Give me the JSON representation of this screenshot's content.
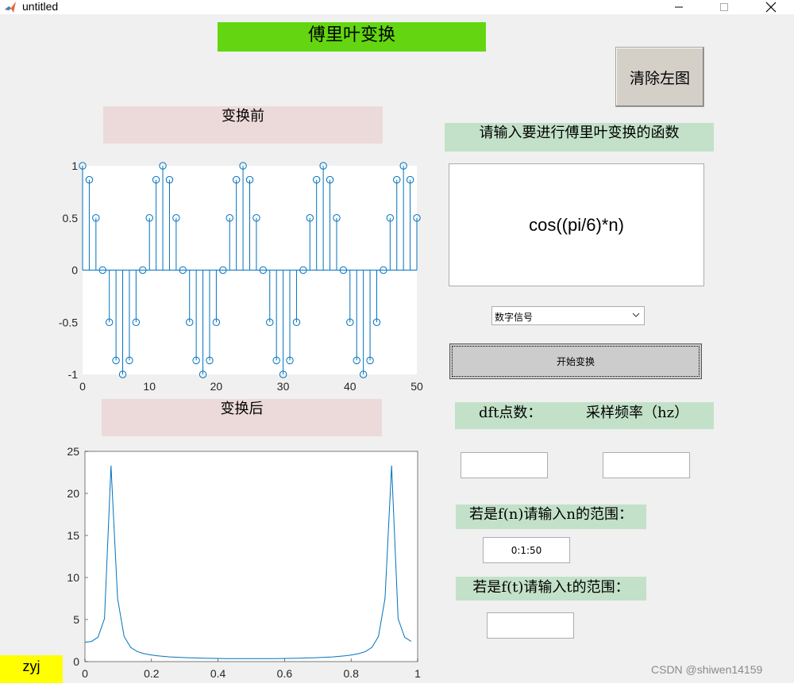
{
  "window": {
    "title": "untitled"
  },
  "banner": "傅里叶变换",
  "clear_button": "清除左图",
  "labels": {
    "before": "变换前",
    "after": "变换后",
    "input_prompt": "请输入要进行傅里叶变换的函数",
    "dft_points": "dft点数：",
    "sample_rate": "采样频率（hz）",
    "n_range": "若是f(n)请输入n的范围：",
    "t_range": "若是f(t)请输入t的范围："
  },
  "function_input": {
    "value": "cos((pi/6)*n)"
  },
  "signal_type": {
    "selected": "数字信号"
  },
  "start_button": "开始变换",
  "inputs": {
    "dft_points": "",
    "sample_rate": "",
    "n_range": "0:1:50",
    "t_range": ""
  },
  "author": "zyj",
  "watermark": "CSDN @shiwen14159",
  "colors": {
    "accent": "#0072bd",
    "banner": "#63d611",
    "pink": "#ecdada",
    "green": "#c3e1c8",
    "author_bg": "#ffff00"
  },
  "chart_data": [
    {
      "type": "stem",
      "title": "",
      "xlabel": "",
      "ylabel": "",
      "xlim": [
        0,
        50
      ],
      "ylim": [
        -1,
        1
      ],
      "xticks": [
        0,
        10,
        20,
        30,
        40,
        50
      ],
      "yticks": [
        -1,
        -0.5,
        0,
        0.5,
        1
      ],
      "series": [
        {
          "function": "cos((pi/6)*n)",
          "x_range": [
            0,
            50,
            1
          ]
        }
      ]
    },
    {
      "type": "line",
      "title": "",
      "xlabel": "",
      "ylabel": "",
      "xlim": [
        0,
        1
      ],
      "ylim": [
        0,
        25
      ],
      "xticks": [
        0,
        0.2,
        0.4,
        0.6,
        0.8,
        1
      ],
      "yticks": [
        0,
        5,
        10,
        15,
        20,
        25
      ],
      "series": [
        {
          "x": [
            0,
            0.0196,
            0.0392,
            0.0588,
            0.0784,
            0.098,
            0.1176,
            0.1373,
            0.1569,
            0.1765,
            0.1961,
            0.2157,
            0.2353,
            0.2549,
            0.2745,
            0.2941,
            0.3137,
            0.3333,
            0.3529,
            0.3725,
            0.3922,
            0.4118,
            0.4314,
            0.451,
            0.4706,
            0.4902,
            0.5098,
            0.5294,
            0.549,
            0.5686,
            0.5882,
            0.6078,
            0.6275,
            0.6471,
            0.6667,
            0.6863,
            0.7059,
            0.7255,
            0.7451,
            0.7647,
            0.7843,
            0.8039,
            0.8235,
            0.8431,
            0.8627,
            0.8824,
            0.902,
            0.9216,
            0.9412,
            0.9608,
            0.9804
          ],
          "values": [
            2.3,
            2.4,
            2.9,
            5.1,
            23.3,
            7.5,
            3.0,
            1.7,
            1.2,
            0.95,
            0.8,
            0.7,
            0.62,
            0.56,
            0.52,
            0.48,
            0.45,
            0.43,
            0.41,
            0.39,
            0.38,
            0.37,
            0.36,
            0.36,
            0.35,
            0.35,
            0.35,
            0.35,
            0.36,
            0.36,
            0.37,
            0.38,
            0.39,
            0.41,
            0.43,
            0.45,
            0.48,
            0.52,
            0.56,
            0.62,
            0.7,
            0.8,
            0.95,
            1.2,
            1.7,
            3.0,
            7.5,
            23.3,
            5.1,
            2.9,
            2.4
          ]
        }
      ]
    }
  ]
}
